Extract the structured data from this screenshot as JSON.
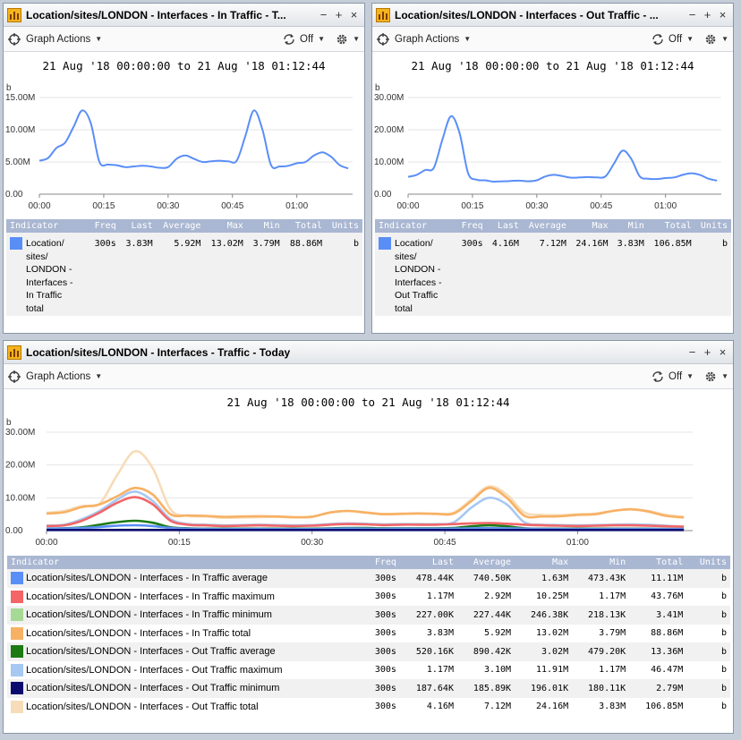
{
  "icons": {
    "app": "chart-app-icon",
    "actions": "crosshair-icon",
    "refresh": "refresh-icon",
    "settings": "gear-icon"
  },
  "toolbar": {
    "graph_actions": "Graph Actions",
    "refresh": "Off"
  },
  "window_buttons": {
    "minimize": "−",
    "maximize": "+",
    "close": "×"
  },
  "legend_headers": {
    "indicator": "Indicator",
    "freq": "Freq",
    "last": "Last",
    "average": "Average",
    "max": "Max",
    "min": "Min",
    "total": "Total",
    "units": "Units"
  },
  "axis": {
    "unit": "b",
    "x_ticks": [
      "00:00",
      "00:15",
      "00:30",
      "00:45",
      "01:00"
    ]
  },
  "panels": [
    {
      "title": "Location/sites/LONDON - Interfaces - In Traffic - T...",
      "range": "21 Aug '18 00:00:00 to 21 Aug '18 01:12:44",
      "rows": [
        {
          "name": "Location/ sites/ LONDON - Interfaces - In Traffic total",
          "color": "#5a8ef7",
          "freq": "300s",
          "last": "3.83M",
          "average": "5.92M",
          "max": "13.02M",
          "min": "3.79M",
          "total": "88.86M",
          "units": "b"
        }
      ]
    },
    {
      "title": "Location/sites/LONDON - Interfaces - Out Traffic - ...",
      "range": "21 Aug '18 00:00:00 to 21 Aug '18 01:12:44",
      "rows": [
        {
          "name": "Location/ sites/ LONDON - Interfaces - Out Traffic total",
          "color": "#5a8ef7",
          "freq": "300s",
          "last": "4.16M",
          "average": "7.12M",
          "max": "24.16M",
          "min": "3.83M",
          "total": "106.85M",
          "units": "b"
        }
      ]
    },
    {
      "title": "Location/sites/LONDON - Interfaces - Traffic - Today",
      "range": "21 Aug '18 00:00:00 to 21 Aug '18 01:12:44",
      "rows": [
        {
          "name": "Location/sites/LONDON - Interfaces - In Traffic average",
          "color": "#5a8ef7",
          "freq": "300s",
          "last": "478.44K",
          "average": "740.50K",
          "max": "1.63M",
          "min": "473.43K",
          "total": "11.11M",
          "units": "b"
        },
        {
          "name": "Location/sites/LONDON - Interfaces - In Traffic maximum",
          "color": "#f36567",
          "freq": "300s",
          "last": "1.17M",
          "average": "2.92M",
          "max": "10.25M",
          "min": "1.17M",
          "total": "43.76M",
          "units": "b"
        },
        {
          "name": "Location/sites/LONDON - Interfaces - In Traffic minimum",
          "color": "#a6d995",
          "freq": "300s",
          "last": "227.00K",
          "average": "227.44K",
          "max": "246.38K",
          "min": "218.13K",
          "total": "3.41M",
          "units": "b"
        },
        {
          "name": "Location/sites/LONDON - Interfaces - In Traffic total",
          "color": "#f7b165",
          "freq": "300s",
          "last": "3.83M",
          "average": "5.92M",
          "max": "13.02M",
          "min": "3.79M",
          "total": "88.86M",
          "units": "b"
        },
        {
          "name": "Location/sites/LONDON - Interfaces - Out Traffic average",
          "color": "#1d7a15",
          "freq": "300s",
          "last": "520.16K",
          "average": "890.42K",
          "max": "3.02M",
          "min": "479.20K",
          "total": "13.36M",
          "units": "b"
        },
        {
          "name": "Location/sites/LONDON - Interfaces - Out Traffic maximum",
          "color": "#a6c8f2",
          "freq": "300s",
          "last": "1.17M",
          "average": "3.10M",
          "max": "11.91M",
          "min": "1.17M",
          "total": "46.47M",
          "units": "b"
        },
        {
          "name": "Location/sites/LONDON - Interfaces - Out Traffic minimum",
          "color": "#0b0a6e",
          "freq": "300s",
          "last": "187.64K",
          "average": "185.89K",
          "max": "196.01K",
          "min": "180.11K",
          "total": "2.79M",
          "units": "b"
        },
        {
          "name": "Location/sites/LONDON - Interfaces - Out Traffic total",
          "color": "#f6dcb8",
          "freq": "300s",
          "last": "4.16M",
          "average": "7.12M",
          "max": "24.16M",
          "min": "3.83M",
          "total": "106.85M",
          "units": "b"
        }
      ]
    }
  ],
  "chart_data": [
    {
      "type": "line",
      "xlabel": "",
      "ylabel": "b",
      "ylim": [
        0,
        15
      ],
      "y_ticks": [
        "0.00",
        "5.00M",
        "10.00M",
        "15.00M"
      ],
      "x": [
        0,
        2,
        4,
        6,
        8,
        10,
        12,
        14,
        16,
        18,
        20,
        22,
        24,
        26,
        28,
        30,
        32,
        34,
        36,
        38,
        40,
        42,
        44,
        46,
        48,
        50,
        52,
        54,
        56,
        58,
        60,
        62,
        64,
        66,
        68,
        70,
        72
      ],
      "series": [
        {
          "color": "#5a8ef7",
          "values": [
            5.2,
            5.6,
            7.2,
            8.0,
            10.5,
            13.0,
            11.0,
            5.0,
            4.6,
            4.5,
            4.2,
            4.3,
            4.4,
            4.3,
            4.1,
            4.2,
            5.5,
            6.0,
            5.5,
            5.0,
            5.1,
            5.2,
            5.1,
            5.2,
            9.0,
            13.0,
            10.0,
            4.5,
            4.3,
            4.4,
            4.8,
            5.0,
            6.0,
            6.5,
            5.8,
            4.5,
            4.0
          ]
        }
      ]
    },
    {
      "type": "line",
      "xlabel": "",
      "ylabel": "b",
      "ylim": [
        0,
        30
      ],
      "y_ticks": [
        "0.00",
        "10.00M",
        "20.00M",
        "30.00M"
      ],
      "x": [
        0,
        2,
        4,
        6,
        8,
        10,
        12,
        14,
        16,
        18,
        20,
        22,
        24,
        26,
        28,
        30,
        32,
        34,
        36,
        38,
        40,
        42,
        44,
        46,
        48,
        50,
        52,
        54,
        56,
        58,
        60,
        62,
        64,
        66,
        68,
        70,
        72
      ],
      "series": [
        {
          "color": "#5a8ef7",
          "values": [
            5.4,
            6.0,
            7.5,
            8.2,
            17.0,
            24.2,
            19.0,
            6.5,
            4.5,
            4.3,
            3.9,
            4.0,
            4.1,
            4.2,
            4.0,
            4.3,
            5.5,
            6.0,
            5.6,
            5.1,
            5.2,
            5.3,
            5.2,
            5.5,
            9.5,
            13.5,
            11.0,
            5.5,
            4.8,
            4.7,
            5.0,
            5.2,
            6.0,
            6.5,
            6.0,
            4.8,
            4.2
          ]
        }
      ]
    },
    {
      "type": "line",
      "xlabel": "",
      "ylabel": "b",
      "ylim": [
        0,
        30
      ],
      "y_ticks": [
        "0.00",
        "10.00M",
        "20.00M",
        "30.00M"
      ],
      "x": [
        0,
        2,
        4,
        6,
        8,
        10,
        12,
        14,
        16,
        18,
        20,
        22,
        24,
        26,
        28,
        30,
        32,
        34,
        36,
        38,
        40,
        42,
        44,
        46,
        48,
        50,
        52,
        54,
        56,
        58,
        60,
        62,
        64,
        66,
        68,
        70,
        72
      ],
      "series": [
        {
          "name": "Location/sites/LONDON - Interfaces - Out Traffic total",
          "color": "#f6dcb8",
          "values": [
            5.4,
            6.0,
            7.5,
            8.2,
            17.0,
            24.2,
            19.0,
            6.5,
            4.5,
            4.3,
            3.9,
            4.0,
            4.1,
            4.2,
            4.0,
            4.3,
            5.5,
            6.0,
            5.6,
            5.1,
            5.2,
            5.3,
            5.2,
            5.5,
            9.5,
            13.5,
            11.0,
            5.5,
            4.8,
            4.7,
            5.0,
            5.2,
            6.0,
            6.5,
            6.0,
            4.8,
            4.2
          ]
        },
        {
          "name": "Location/sites/LONDON - Interfaces - In Traffic total",
          "color": "#f7b165",
          "values": [
            5.2,
            5.6,
            7.2,
            8.0,
            10.5,
            13.0,
            11.0,
            5.0,
            4.6,
            4.5,
            4.2,
            4.3,
            4.4,
            4.3,
            4.1,
            4.2,
            5.5,
            6.0,
            5.5,
            5.0,
            5.1,
            5.2,
            5.1,
            5.2,
            9.0,
            13.0,
            10.0,
            4.5,
            4.3,
            4.4,
            4.8,
            5.0,
            6.0,
            6.5,
            5.8,
            4.5,
            4.0
          ]
        },
        {
          "name": "Location/sites/LONDON - Interfaces - Out Traffic maximum",
          "color": "#a6c8f2",
          "values": [
            1.5,
            1.8,
            3.5,
            6.0,
            9.5,
            11.9,
            9.0,
            3.5,
            2.0,
            1.8,
            1.6,
            1.7,
            1.8,
            1.7,
            1.6,
            1.7,
            2.0,
            2.2,
            2.1,
            1.9,
            2.0,
            2.0,
            2.0,
            2.5,
            7.0,
            10.0,
            8.0,
            2.5,
            1.8,
            1.7,
            1.6,
            1.7,
            1.8,
            1.9,
            1.8,
            1.5,
            1.2
          ]
        },
        {
          "name": "Location/sites/LONDON - Interfaces - In Traffic maximum",
          "color": "#f36567",
          "values": [
            1.4,
            1.6,
            3.0,
            5.5,
            8.5,
            10.2,
            8.0,
            3.0,
            1.8,
            1.6,
            1.4,
            1.5,
            1.6,
            1.5,
            1.4,
            1.5,
            1.8,
            2.0,
            1.9,
            1.7,
            1.8,
            1.8,
            1.8,
            2.0,
            2.2,
            2.3,
            2.1,
            1.8,
            1.6,
            1.5,
            1.4,
            1.5,
            1.6,
            1.6,
            1.5,
            1.3,
            1.2
          ]
        },
        {
          "name": "Location/sites/LONDON - Interfaces - Out Traffic average",
          "color": "#1d7a15",
          "values": [
            0.6,
            0.7,
            1.0,
            1.8,
            2.6,
            3.0,
            2.4,
            1.0,
            0.7,
            0.6,
            0.6,
            0.6,
            0.6,
            0.6,
            0.6,
            0.6,
            0.7,
            0.8,
            0.8,
            0.7,
            0.7,
            0.7,
            0.7,
            0.8,
            1.3,
            1.6,
            1.3,
            0.7,
            0.6,
            0.6,
            0.6,
            0.6,
            0.6,
            0.6,
            0.6,
            0.5,
            0.5
          ]
        },
        {
          "name": "Location/sites/LONDON - Interfaces - In Traffic average",
          "color": "#5a8ef7",
          "values": [
            0.6,
            0.65,
            0.8,
            1.1,
            1.5,
            1.63,
            1.4,
            0.8,
            0.6,
            0.55,
            0.5,
            0.5,
            0.52,
            0.5,
            0.5,
            0.5,
            0.6,
            0.65,
            0.62,
            0.58,
            0.6,
            0.6,
            0.6,
            0.62,
            0.7,
            0.75,
            0.7,
            0.6,
            0.55,
            0.52,
            0.5,
            0.5,
            0.52,
            0.53,
            0.52,
            0.5,
            0.48
          ]
        },
        {
          "name": "Location/sites/LONDON - Interfaces - In Traffic minimum",
          "color": "#a6d995",
          "values": [
            0.23,
            0.23,
            0.23,
            0.23,
            0.24,
            0.25,
            0.24,
            0.23,
            0.23,
            0.23,
            0.22,
            0.22,
            0.22,
            0.22,
            0.22,
            0.22,
            0.23,
            0.23,
            0.23,
            0.23,
            0.23,
            0.23,
            0.23,
            0.23,
            0.23,
            0.24,
            0.23,
            0.23,
            0.22,
            0.22,
            0.22,
            0.22,
            0.22,
            0.22,
            0.22,
            0.22,
            0.22
          ]
        },
        {
          "name": "Location/sites/LONDON - Interfaces - Out Traffic minimum",
          "color": "#0b0a6e",
          "values": [
            0.19,
            0.19,
            0.19,
            0.19,
            0.19,
            0.2,
            0.19,
            0.19,
            0.19,
            0.19,
            0.18,
            0.18,
            0.18,
            0.18,
            0.18,
            0.18,
            0.19,
            0.19,
            0.19,
            0.19,
            0.19,
            0.19,
            0.19,
            0.19,
            0.19,
            0.19,
            0.19,
            0.19,
            0.18,
            0.18,
            0.18,
            0.18,
            0.18,
            0.18,
            0.18,
            0.18,
            0.18
          ]
        }
      ]
    }
  ]
}
